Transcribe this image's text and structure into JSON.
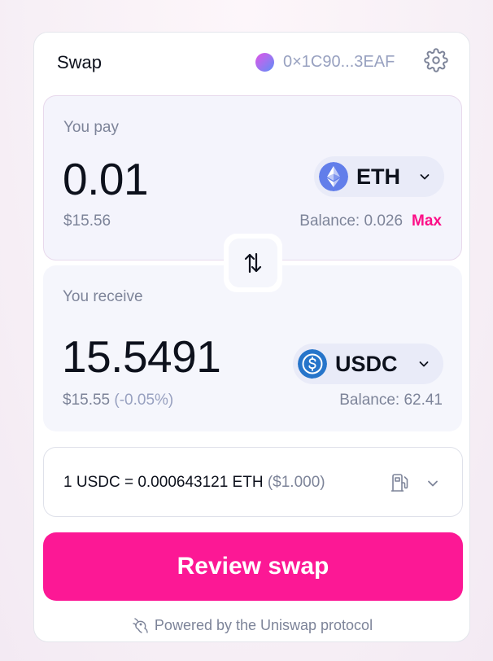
{
  "header": {
    "title": "Swap",
    "wallet_address": "0×1C90...3EAF"
  },
  "pay": {
    "label": "You pay",
    "amount": "0.01",
    "token": "ETH",
    "usd_value": "$15.56",
    "balance": "Balance: 0.026",
    "max_label": "Max"
  },
  "receive": {
    "label": "You receive",
    "amount": "15.5491",
    "token": "USDC",
    "usd_value": "$15.55",
    "price_impact": "(-0.05%)",
    "balance": "Balance: 62.41"
  },
  "rate": {
    "text": "1 USDC = 0.000643121 ETH",
    "usd": "($1.000)"
  },
  "review_button": "Review swap",
  "footer": "Powered by the Uniswap protocol",
  "colors": {
    "accent": "#fc1895",
    "max": "#fc0f87",
    "eth_token": "#627eea",
    "usdc_token": "#2775ca"
  },
  "icons": [
    "wallet-avatar",
    "gear-icon",
    "eth-icon",
    "usdc-icon",
    "chevron-down-icon",
    "swap-arrows-icon",
    "gas-pump-icon",
    "uniswap-unicorn-icon"
  ]
}
